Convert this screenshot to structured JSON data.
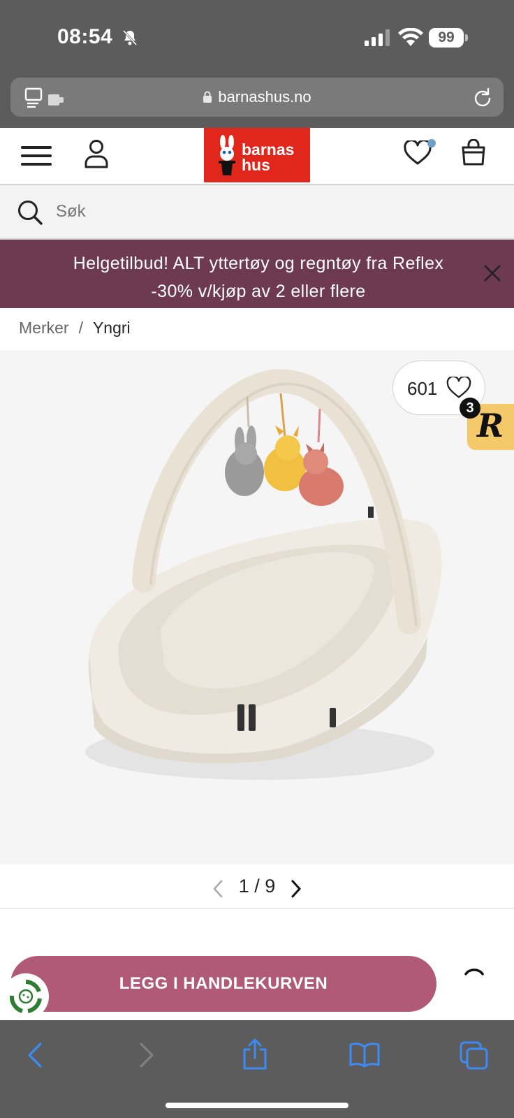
{
  "status_bar": {
    "time": "08:54",
    "battery": "99",
    "icons": [
      "bell-slash-icon",
      "signal-icon",
      "wifi-icon",
      "battery-icon"
    ]
  },
  "browser": {
    "url": "barnashus.no",
    "icons": [
      "tab-overview-icon",
      "lock-icon",
      "reload-icon"
    ]
  },
  "site_header": {
    "logo_line1": "barnas",
    "logo_line2": "hus",
    "icons": [
      "menu-icon",
      "user-icon",
      "heart-icon",
      "shopping-bag-icon"
    ],
    "brand_color": "#e1261c"
  },
  "search": {
    "placeholder": "Søk",
    "value": ""
  },
  "promo": {
    "line1": "Helgetilbud! ALT yttertøy og regntøy fra Reflex",
    "line2": "-30% v/kjøp av 2 eller flere",
    "background": "#6e3a52"
  },
  "breadcrumb": {
    "items": [
      "Merker",
      "Yngri"
    ],
    "separator": "/"
  },
  "product": {
    "favorite_count": "601",
    "reviews_badge_letter": "R",
    "reviews_badge_count": "3",
    "image_alt": "baby nest with play arch and plush toys"
  },
  "pager": {
    "current": "1",
    "separator": "/",
    "total": "9"
  },
  "cta": {
    "label": "LEGG I HANDLEKURVEN",
    "color": "#b05a78"
  },
  "safari_toolbar": {
    "icons": [
      "back-icon",
      "forward-icon",
      "share-icon",
      "bookmarks-icon",
      "tabs-icon"
    ]
  }
}
